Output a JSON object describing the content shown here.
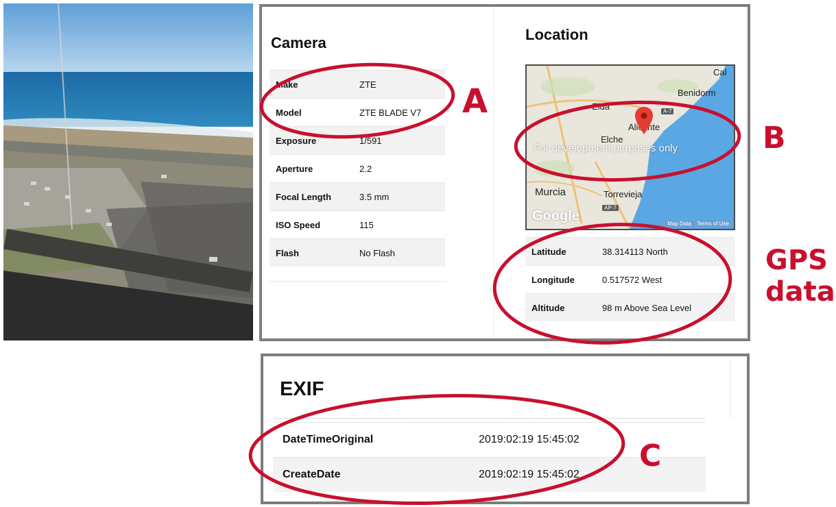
{
  "camera": {
    "title": "Camera",
    "rows": [
      {
        "key": "Make",
        "value": "ZTE"
      },
      {
        "key": "Model",
        "value": "ZTE BLADE V7"
      },
      {
        "key": "Exposure",
        "value": "1/591"
      },
      {
        "key": "Aperture",
        "value": "2.2"
      },
      {
        "key": "Focal Length",
        "value": "3.5 mm"
      },
      {
        "key": "ISO Speed",
        "value": "115"
      },
      {
        "key": "Flash",
        "value": "No Flash"
      }
    ]
  },
  "location": {
    "title": "Location",
    "map": {
      "labels": {
        "cal": "Cal",
        "benidorm": "Benidorm",
        "elda": "Elda",
        "alicante": "Alicante",
        "elche": "Elche",
        "murcia": "Murcia",
        "torrevieja": "Torrevieja",
        "ap7": "AP-7",
        "a7": "A-7"
      },
      "dev_notice": "For development purposes only",
      "logo": "Google",
      "map_data": "Map Data",
      "terms": "Terms of Use"
    },
    "gps": [
      {
        "key": "Latitude",
        "value": "38.314113 North"
      },
      {
        "key": "Longitude",
        "value": "0.517572 West"
      },
      {
        "key": "Altitude",
        "value": "98 m Above Sea Level"
      }
    ]
  },
  "exif": {
    "title": "EXIF",
    "rows": [
      {
        "key": "DateTimeOriginal",
        "value": "2019:02:19 15:45:02"
      },
      {
        "key": "CreateDate",
        "value": "2019:02:19 15:45:02"
      }
    ]
  },
  "annotations": {
    "a": "A",
    "b": "B",
    "c": "C",
    "gps_line1": "GPS",
    "gps_line2": "data",
    "color": "#c8102e"
  },
  "colors": {
    "sea": "#2f86c8",
    "panel_border": "#7d7d7d",
    "map_water": "#5aa7e3"
  }
}
